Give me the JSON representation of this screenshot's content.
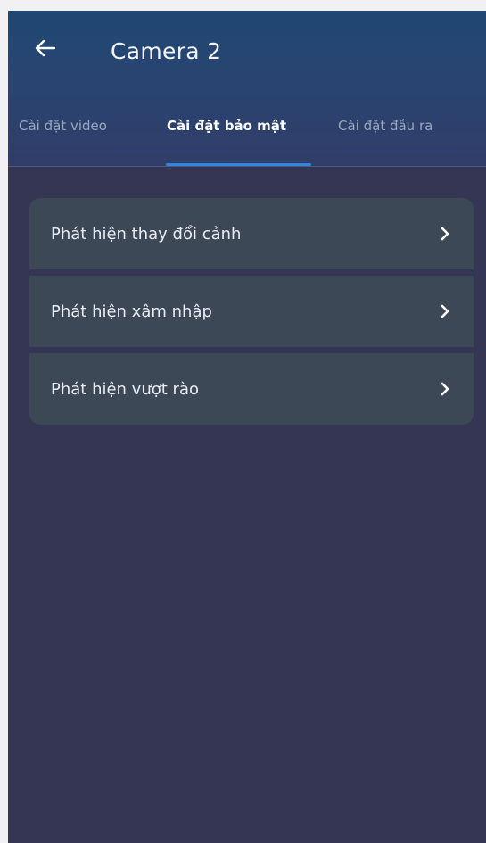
{
  "header": {
    "title": "Camera 2",
    "back_icon": "arrow-left-icon"
  },
  "tabs": [
    {
      "label": "Cài đặt video",
      "active": false
    },
    {
      "label": "Cài đặt bảo mật",
      "active": true
    },
    {
      "label": "Cài đặt đầu ra",
      "active": false
    }
  ],
  "security_settings": {
    "items": [
      {
        "label": "Phát hiện thay đổi cảnh",
        "icon": "chevron-right-icon"
      },
      {
        "label": "Phát hiện xâm nhập",
        "icon": "chevron-right-icon"
      },
      {
        "label": "Phát hiện vượt rào",
        "icon": "chevron-right-icon"
      }
    ]
  },
  "colors": {
    "header_top": "#1f4773",
    "background": "#343654",
    "card": "#3d4857",
    "accent": "#2f87e0"
  }
}
